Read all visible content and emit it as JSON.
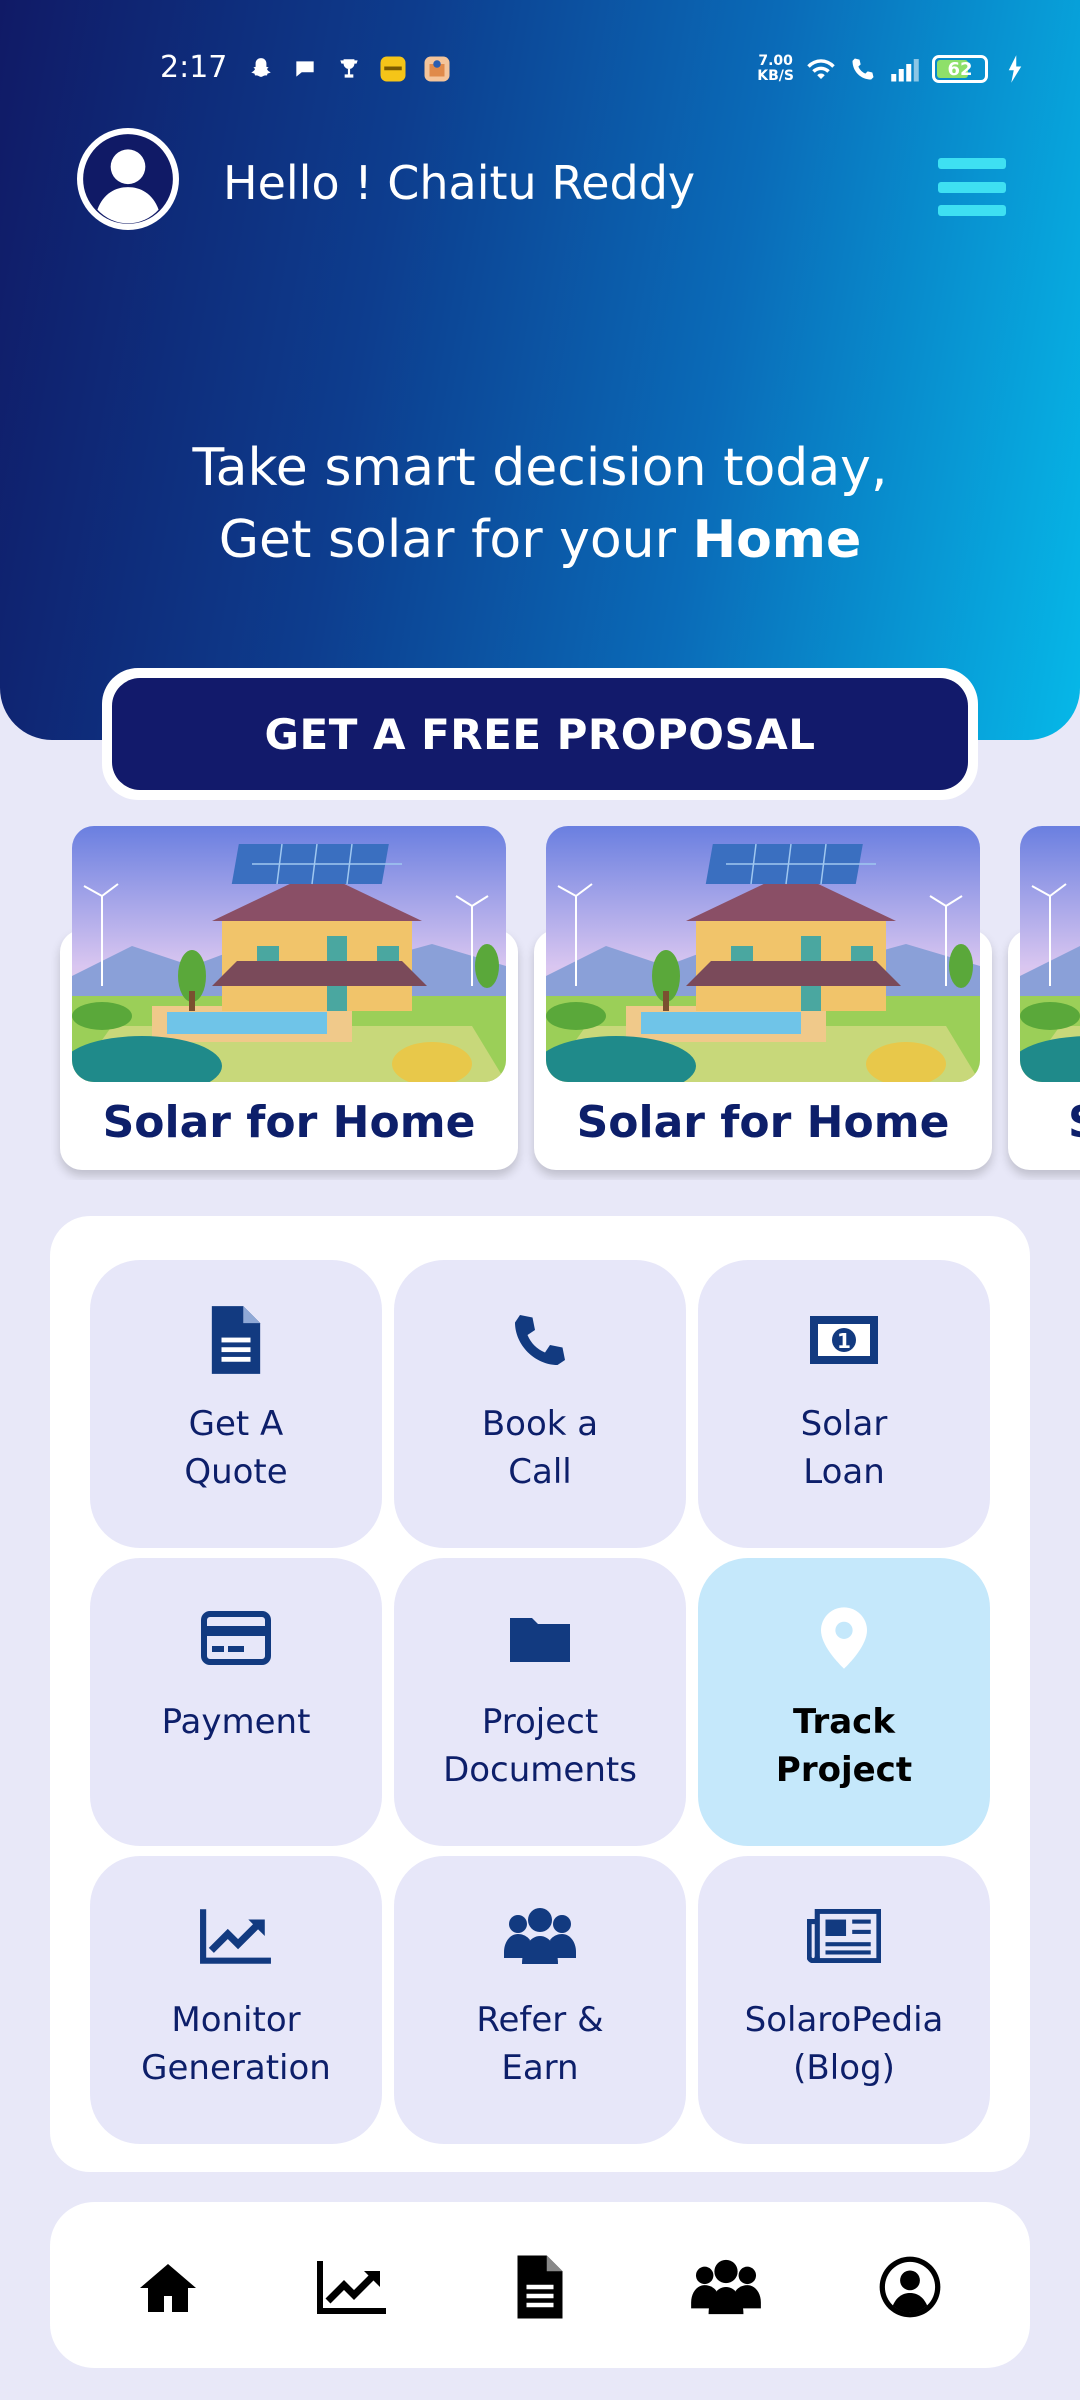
{
  "status_bar": {
    "time": "2:17",
    "speed_value": "7.00",
    "speed_unit": "KB/S",
    "battery": "62"
  },
  "header": {
    "greeting": "Hello ! Chaitu Reddy"
  },
  "hero": {
    "tagline_line1": "Take smart decision today,",
    "tagline_line2_prefix": "Get solar for your ",
    "tagline_line2_bold": "Home"
  },
  "proposal_button": "GET A FREE PROPOSAL",
  "carousel": {
    "cards": [
      {
        "title": "Solar for Home"
      },
      {
        "title": "Solar for Home"
      },
      {
        "title": "Solar for Home"
      }
    ]
  },
  "services": [
    {
      "line1": "Get A",
      "line2": "Quote",
      "icon": "document-icon"
    },
    {
      "line1": "Book a",
      "line2": "Call",
      "icon": "phone-icon"
    },
    {
      "line1": "Solar",
      "line2": "Loan",
      "icon": "money-icon"
    },
    {
      "line1": "Payment",
      "line2": "",
      "icon": "credit-card-icon"
    },
    {
      "line1": "Project",
      "line2": "Documents",
      "icon": "folder-icon"
    },
    {
      "line1": "Track",
      "line2": "Project",
      "icon": "location-pin-icon",
      "active": true
    },
    {
      "line1": "Monitor",
      "line2": "Generation",
      "icon": "chart-line-icon"
    },
    {
      "line1": "Refer &",
      "line2": "Earn",
      "icon": "users-icon"
    },
    {
      "line1": "SolaroPedia",
      "line2": "(Blog)",
      "icon": "newspaper-icon"
    }
  ],
  "bottom_nav": [
    "home-icon",
    "chart-line-icon",
    "document-icon",
    "users-icon",
    "user-circle-icon"
  ],
  "colors": {
    "primary_navy": "#121a6b",
    "text_navy": "#0d1f6a",
    "accent_cyan": "#3ee0f2",
    "active_tile": "#c5e8fb",
    "tile_bg": "#e7e7f9"
  }
}
